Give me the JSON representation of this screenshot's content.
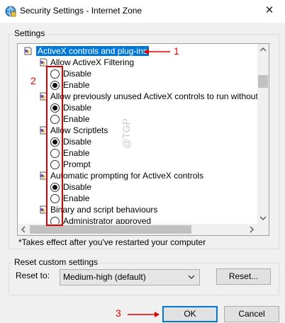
{
  "window": {
    "title": "Security Settings - Internet Zone",
    "close_glyph": "✕"
  },
  "settings_group_label": "Settings",
  "tree": [
    {
      "type": "category",
      "label": "ActiveX controls and plug-ins",
      "selected": true
    },
    {
      "type": "setting",
      "label": "Allow ActiveX Filtering"
    },
    {
      "type": "option",
      "label": "Disable",
      "checked": false
    },
    {
      "type": "option",
      "label": "Enable",
      "checked": true
    },
    {
      "type": "setting",
      "label": "Allow previously unused ActiveX controls to run without prom"
    },
    {
      "type": "option",
      "label": "Disable",
      "checked": true
    },
    {
      "type": "option",
      "label": "Enable",
      "checked": false
    },
    {
      "type": "setting",
      "label": "Allow Scriptlets"
    },
    {
      "type": "option",
      "label": "Disable",
      "checked": true
    },
    {
      "type": "option",
      "label": "Enable",
      "checked": false
    },
    {
      "type": "option",
      "label": "Prompt",
      "checked": false
    },
    {
      "type": "setting",
      "label": "Automatic prompting for ActiveX controls"
    },
    {
      "type": "option",
      "label": "Disable",
      "checked": true
    },
    {
      "type": "option",
      "label": "Enable",
      "checked": false
    },
    {
      "type": "setting",
      "label": "Binary and script behaviours"
    },
    {
      "type": "option",
      "label": "Administrator approved",
      "checked": false
    }
  ],
  "note": "*Takes effect after you've restarted your computer",
  "reset_group_label": "Reset custom settings",
  "reset_to_label": "Reset to:",
  "reset_select_value": "Medium-high (default)",
  "reset_button": "Reset...",
  "ok_button": "OK",
  "cancel_button": "Cancel",
  "annotations": {
    "a1": "1",
    "a2": "2",
    "a3": "3"
  },
  "watermark": "@TGP",
  "colors": {
    "selection": "#0078d7",
    "annotation": "#e00000"
  }
}
